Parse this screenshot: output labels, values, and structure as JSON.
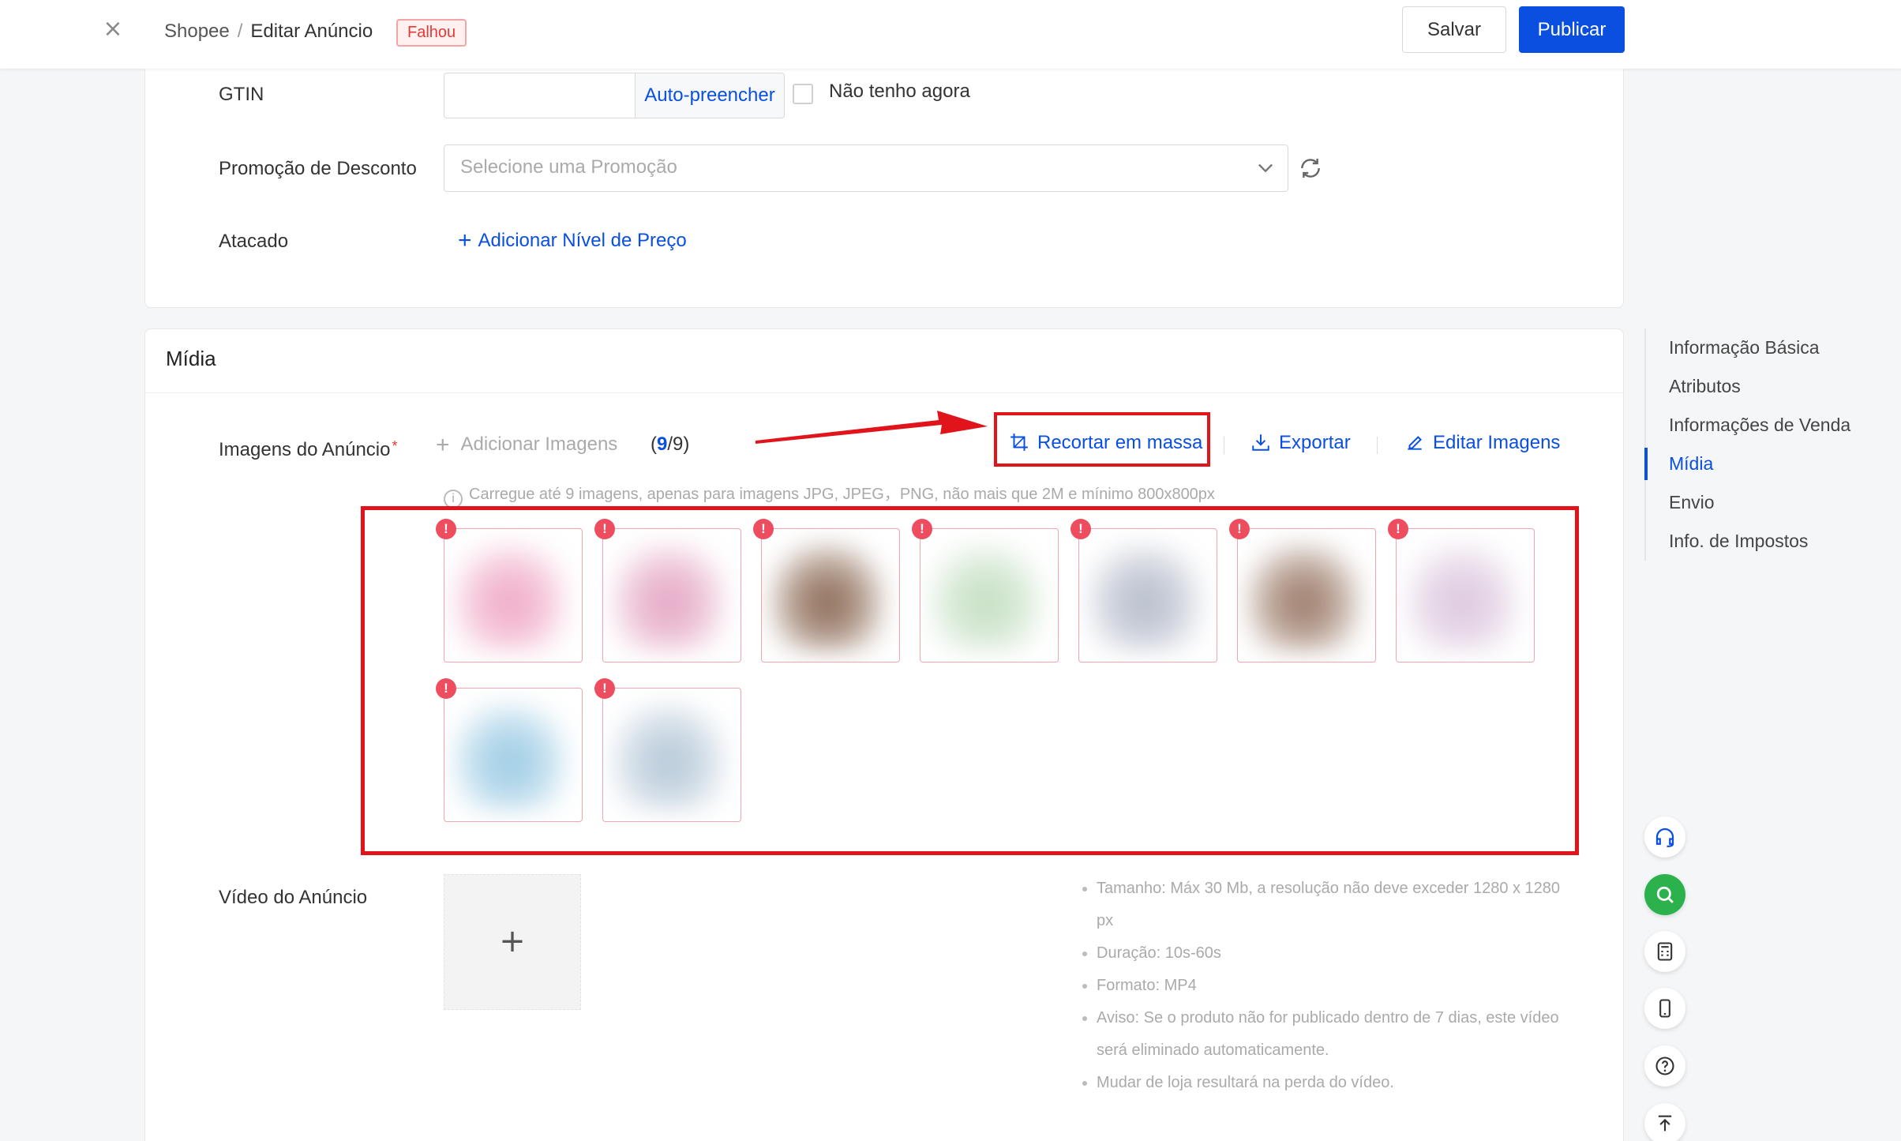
{
  "header": {
    "breadcrumb_root": "Shopee",
    "breadcrumb_sep": "/",
    "breadcrumb_current": "Editar Anúncio",
    "status_badge": "Falhou",
    "save_label": "Salvar",
    "publish_label": "Publicar"
  },
  "sales": {
    "gtin_label": "GTIN",
    "gtin_value": "",
    "autofill_label": "Auto-preencher",
    "no_gtin_label": "Não tenho agora",
    "no_gtin_checked": false,
    "promo_label": "Promoção de Desconto",
    "promo_placeholder": "Selecione uma Promoção",
    "wholesale_label": "Atacado",
    "add_tier_label": "Adicionar Nível de Preço"
  },
  "media": {
    "title": "Mídia",
    "images_label": "Imagens do Anúncio",
    "required_mark": "*",
    "add_images_label": "Adicionar Imagens",
    "count_open": "(",
    "count_current": "9",
    "count_total": "/9)",
    "crop_label": "Recortar em massa",
    "export_label": "Exportar",
    "edit_label": "Editar Imagens",
    "hint": "Carregue até 9 imagens, apenas para imagens JPG, JPEG，PNG, não mais que 2M e mínimo 800x800px",
    "error_glyph": "!",
    "thumb_colors": [
      "#f0a9c7",
      "#e4a6c4",
      "#8c6a55",
      "#c4dfc2",
      "#b6bccb",
      "#9b7a68",
      "#dcc6de",
      "#9ccbe4",
      "#b6c8d8"
    ],
    "video_label": "Vídeo do Anúncio",
    "video_add_glyph": "+",
    "video_notes": [
      "Tamanho: Máx 30 Mb, a resolução não deve exceder 1280 x 1280 px",
      "Duração: 10s-60s",
      "Formato: MP4",
      "Aviso: Se o produto não for publicado dentro de 7 dias, este vídeo será eliminado automaticamente.",
      "Mudar de loja resultará na perda do vídeo."
    ]
  },
  "side_nav": {
    "items": [
      "Informação Básica",
      "Atributos",
      "Informações de Venda",
      "Mídia",
      "Envio",
      "Info. de Impostos"
    ],
    "active_index": 3
  },
  "floating_tools": [
    "headset-icon",
    "search-icon",
    "calculator-icon",
    "mobile-icon",
    "help-icon",
    "back-to-top-icon"
  ],
  "colors": {
    "accent": "#0a4fe0",
    "highlight": "#e1141c",
    "error": "#ee4d5f",
    "green": "#2bb24c"
  }
}
